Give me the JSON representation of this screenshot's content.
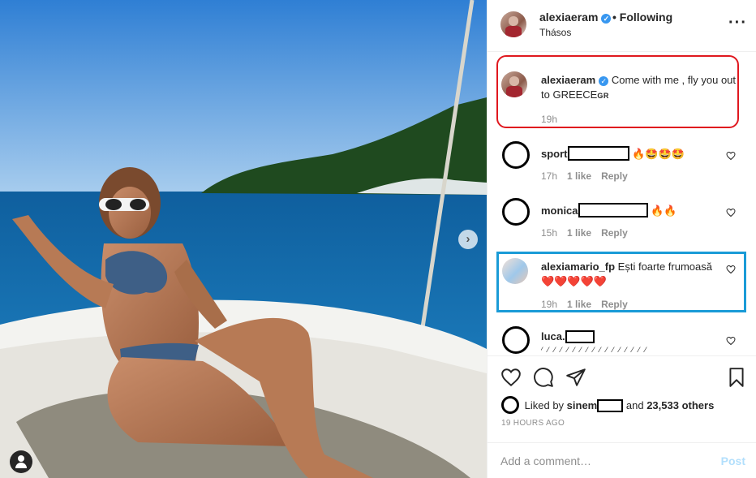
{
  "post": {
    "username": "alexiaeram",
    "follow_sep": "•",
    "follow_status": "Following",
    "location": "Thásos",
    "more_icon": "more-horizontal-icon"
  },
  "caption": {
    "username": "alexiaeram",
    "text": "Come with me , fly you out to GREECE",
    "flag": "GR",
    "time": "19h"
  },
  "comments": [
    {
      "username": "sport",
      "emoji": "🔥🤩🤩🤩",
      "time": "17h",
      "likes": "1 like",
      "reply": "Reply"
    },
    {
      "username": "monica",
      "emoji": "🔥🔥",
      "time": "15h",
      "likes": "1 like",
      "reply": "Reply"
    },
    {
      "username": "alexiamario_fp",
      "text": "Ești foarte frumoasă",
      "emoji": "❤️❤️❤️❤️❤️",
      "time": "19h",
      "likes": "1 like",
      "reply": "Reply"
    },
    {
      "username": "luca."
    }
  ],
  "likes": {
    "prefix": "Liked by",
    "user": "sinem",
    "and": "and",
    "count": "23,533 others"
  },
  "timestamp": "19 HOURS AGO",
  "composer": {
    "placeholder": "Add a comment…",
    "post_label": "Post"
  },
  "colors": {
    "caption_highlight": "#e0181f",
    "comment_highlight": "#1a9bd7",
    "verified": "#3897f0",
    "post_disabled": "#b2dffc"
  }
}
